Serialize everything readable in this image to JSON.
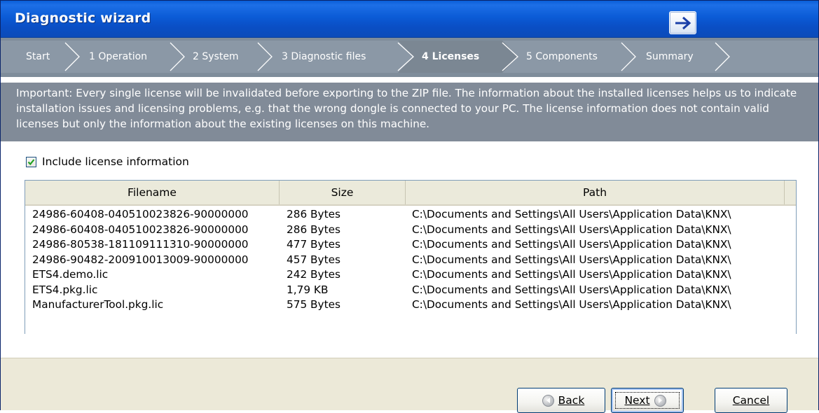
{
  "window": {
    "title": "Diagnostic wizard",
    "title_button_icon": "arrow-right-icon"
  },
  "breadcrumbs": [
    {
      "label": "Start",
      "active": false
    },
    {
      "label": "1 Operation",
      "active": false
    },
    {
      "label": "2 System",
      "active": false
    },
    {
      "label": "3 Diagnostic files",
      "active": false
    },
    {
      "label": "4 Licenses",
      "active": true
    },
    {
      "label": "5 Components",
      "active": false
    },
    {
      "label": "Summary",
      "active": false
    }
  ],
  "info_text": "Important: Every single license will be invalidated before exporting to the ZIP file. The information about the installed licenses helps us to indicate installation issues and licensing problems, e.g. that the wrong dongle is connected to your PC. The license information does not contain valid licenses but only the information about the existing licenses on this machine.",
  "include_license": {
    "label": "Include license information",
    "checked": true
  },
  "table": {
    "columns": [
      "Filename",
      "Size",
      "Path"
    ],
    "rows": [
      [
        "24986-60408-040510023826-90000000",
        "286 Bytes",
        "C:\\Documents and Settings\\All Users\\Application Data\\KNX\\"
      ],
      [
        "24986-60408-040510023826-90000000",
        "286 Bytes",
        "C:\\Documents and Settings\\All Users\\Application Data\\KNX\\"
      ],
      [
        "24986-80538-181109111310-90000000",
        "477 Bytes",
        "C:\\Documents and Settings\\All Users\\Application Data\\KNX\\"
      ],
      [
        "24986-90482-200910013009-90000000",
        "457 Bytes",
        "C:\\Documents and Settings\\All Users\\Application Data\\KNX\\"
      ],
      [
        "ETS4.demo.lic",
        "242 Bytes",
        "C:\\Documents and Settings\\All Users\\Application Data\\KNX\\"
      ],
      [
        "ETS4.pkg.lic",
        "1,79 KB",
        "C:\\Documents and Settings\\All Users\\Application Data\\KNX\\"
      ],
      [
        "ManufacturerTool.pkg.lic",
        "575 Bytes",
        "C:\\Documents and Settings\\All Users\\Application Data\\KNX\\"
      ]
    ]
  },
  "buttons": {
    "back": "Back",
    "next": "Next",
    "cancel": "Cancel"
  },
  "colors": {
    "titlebar": "#0b5bd6",
    "crumb_bar": "#8b98a6",
    "info_panel": "#818b98",
    "footer": "#ece9d8"
  }
}
